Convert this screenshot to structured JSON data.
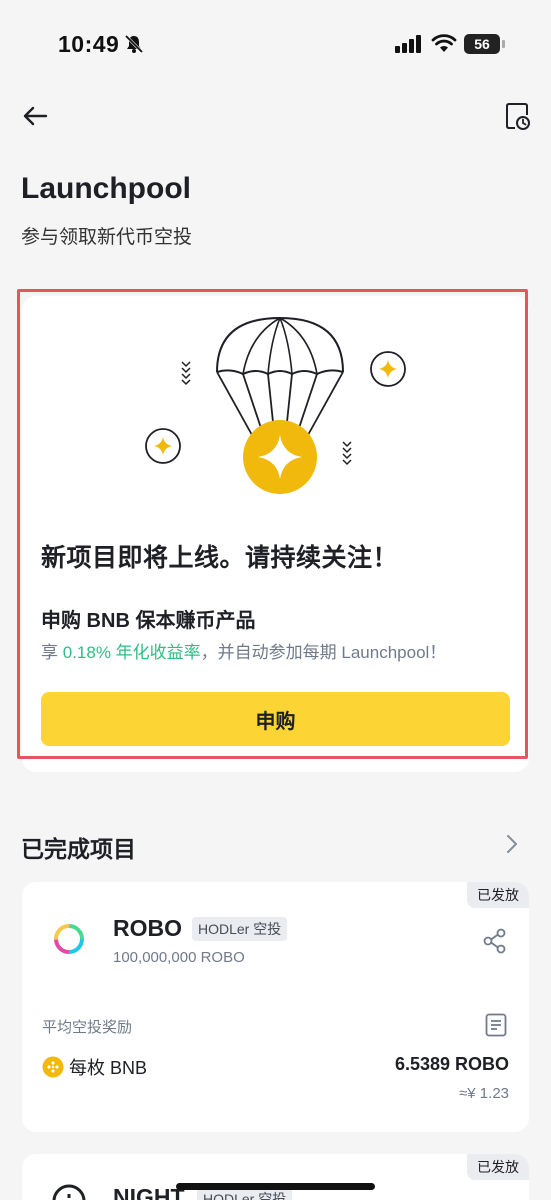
{
  "status_bar": {
    "time": "10:49",
    "battery": "56"
  },
  "header": {
    "title": "Launchpool",
    "subtitle": "参与领取新代币空投"
  },
  "promo": {
    "heading": "新项目即将上线。请持续关注！",
    "product": "申购 BNB 保本赚币产品",
    "desc_prefix": "享 ",
    "desc_rate": "0.18% 年化收益率",
    "desc_suffix": "，并自动参加每期 Launchpool！",
    "button_label": "申购"
  },
  "completed": {
    "title": "已完成项目",
    "projects": [
      {
        "status": "已发放",
        "name": "ROBO",
        "tag": "HODLer 空投",
        "supply": "100,000,000 ROBO",
        "reward_label": "平均空投奖励",
        "per_label": "每枚 BNB",
        "reward_value": "6.5389 ROBO",
        "reward_fiat": "≈¥ 1.23"
      },
      {
        "status": "已发放",
        "name": "NIGHT",
        "tag": "HODLer 空投"
      }
    ]
  },
  "colors": {
    "accent_yellow": "#fcd535",
    "coin_yellow": "#f0b90b",
    "green": "#2ebd85",
    "highlight_red": "#e5555e"
  }
}
